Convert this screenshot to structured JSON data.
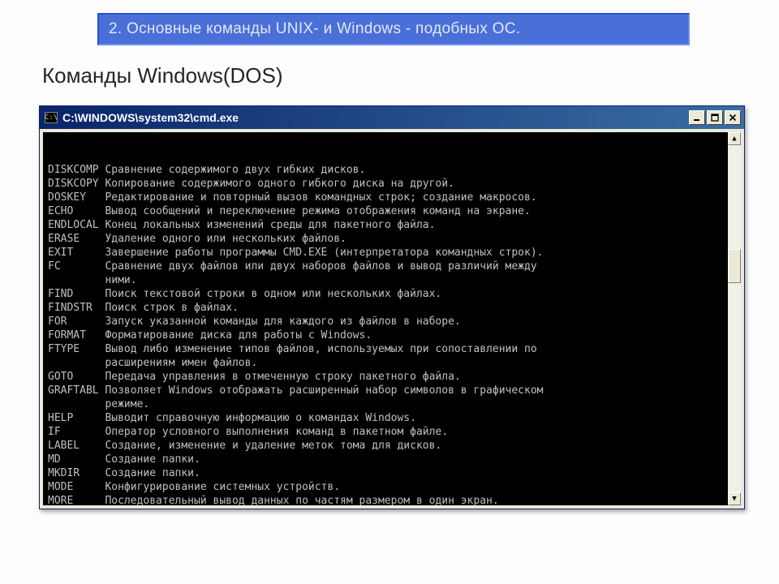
{
  "banner": "2. Основные команды UNIX- и Windows - подобных ОС.",
  "pageTitle": "Команды Windows(DOS)",
  "window": {
    "title": "C:\\WINDOWS\\system32\\cmd.exe",
    "iconGlyph": "C:\\"
  },
  "commands": [
    {
      "name": "DISKCOMP",
      "desc": "Сравнение содержимого двух гибких дисков."
    },
    {
      "name": "DISKCOPY",
      "desc": "Копирование содержимого одного гибкого диска на другой."
    },
    {
      "name": "DOSKEY",
      "desc": "Редактирование и повторный вызов командных строк; создание макросов."
    },
    {
      "name": "ECHO",
      "desc": "Вывод сообщений и переключение режима отображения команд на экране."
    },
    {
      "name": "ENDLOCAL",
      "desc": "Конец локальных изменений среды для пакетного файла."
    },
    {
      "name": "ERASE",
      "desc": "Удаление одного или нескольких файлов."
    },
    {
      "name": "EXIT",
      "desc": "Завершение работы программы CMD.EXE (интерпретатора командных строк)."
    },
    {
      "name": "FC",
      "desc": "Сравнение двух файлов или двух наборов файлов и вывод различий между"
    },
    {
      "name": "",
      "desc": "ними."
    },
    {
      "name": "FIND",
      "desc": "Поиск текстовой строки в одном или нескольких файлах."
    },
    {
      "name": "FINDSTR",
      "desc": "Поиск строк в файлах."
    },
    {
      "name": "FOR",
      "desc": "Запуск указанной команды для каждого из файлов в наборе."
    },
    {
      "name": "FORMAT",
      "desc": "Форматирование диска для работы с Windows."
    },
    {
      "name": "FTYPE",
      "desc": "Вывод либо изменение типов файлов, используемых при сопоставлении по"
    },
    {
      "name": "",
      "desc": "расширениям имен файлов."
    },
    {
      "name": "GOTO",
      "desc": "Передача управления в отмеченную строку пакетного файла."
    },
    {
      "name": "GRAFTABL",
      "desc": "Позволяет Windows отображать расширенный набор символов в графическом"
    },
    {
      "name": "",
      "desc": "режиме."
    },
    {
      "name": "HELP",
      "desc": "Выводит справочную информацию о командах Windows."
    },
    {
      "name": "IF",
      "desc": "Оператор условного выполнения команд в пакетном файле."
    },
    {
      "name": "LABEL",
      "desc": "Создание, изменение и удаление меток тома для дисков."
    },
    {
      "name": "MD",
      "desc": "Создание папки."
    },
    {
      "name": "MKDIR",
      "desc": "Создание папки."
    },
    {
      "name": "MODE",
      "desc": "Конфигурирование системных устройств."
    },
    {
      "name": "MORE",
      "desc": "Последовательный вывод данных по частям размером в один экран."
    }
  ]
}
